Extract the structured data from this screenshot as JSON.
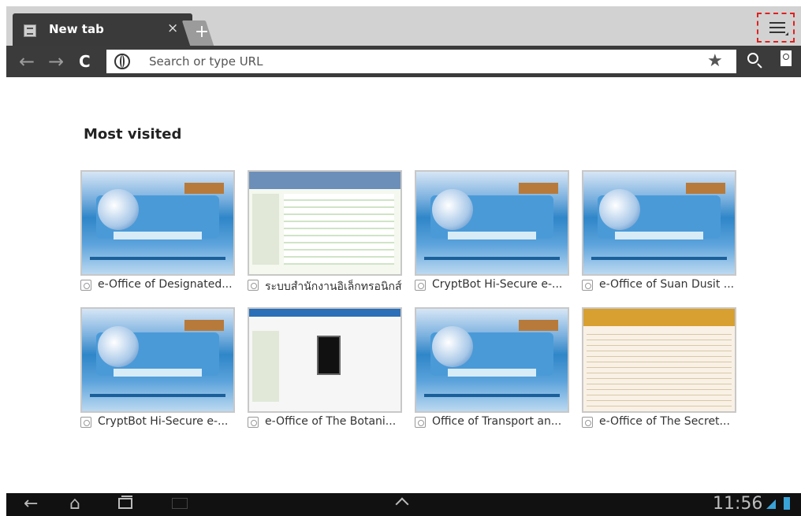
{
  "tabs": [
    {
      "title": "New tab"
    }
  ],
  "tab_close_glyph": "×",
  "new_tab_glyph": "+",
  "toolbar": {
    "back_glyph": "←",
    "forward_glyph": "→",
    "reload_glyph": "C",
    "url_placeholder": "Search or type URL",
    "star_glyph": "★"
  },
  "most_visited": {
    "heading": "Most visited",
    "tiles": [
      {
        "title": "e-Office of Designated...",
        "style": "blue"
      },
      {
        "title": "ระบบสำนักงานอิเล็กทรอนิกส์ สำนั",
        "style": "table"
      },
      {
        "title": "CryptBot Hi-Secure e-...",
        "style": "blue"
      },
      {
        "title": "e-Office of Suan Dusit ...",
        "style": "blue"
      },
      {
        "title": "CryptBot Hi-Secure e-...",
        "style": "blue"
      },
      {
        "title": "e-Office of The Botani...",
        "style": "phone"
      },
      {
        "title": "Office of Transport an...",
        "style": "blue"
      },
      {
        "title": "e-Office of The Secret...",
        "style": "text"
      }
    ]
  },
  "system_bar": {
    "time": "11:56",
    "back_glyph": "←",
    "home_glyph": "⌂"
  },
  "colors": {
    "tabstrip": "#d2d2d2",
    "toolbar": "#3b3b3b",
    "highlight": "#e02020",
    "status_accent": "#3aa3d8"
  }
}
